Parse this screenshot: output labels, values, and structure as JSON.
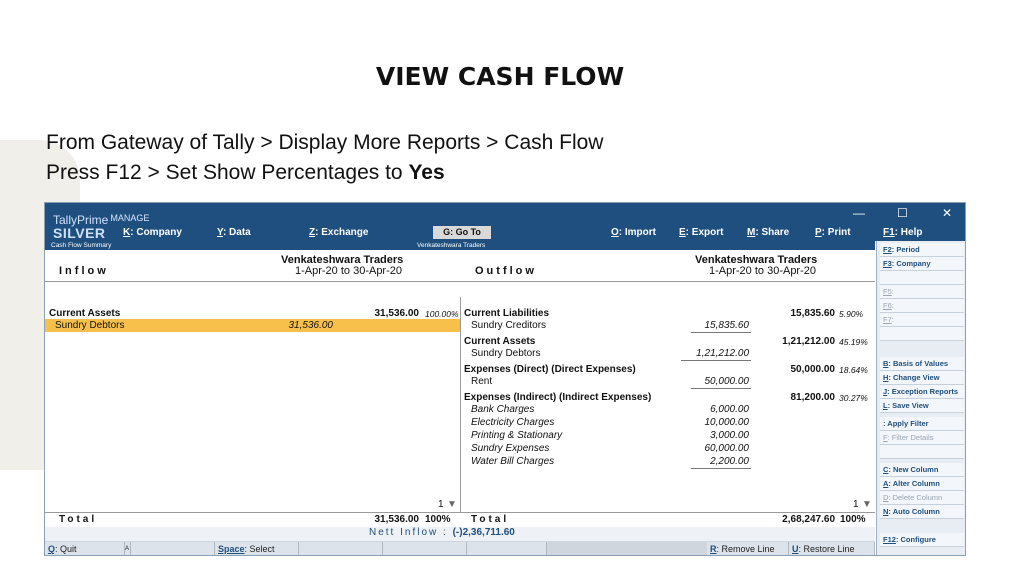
{
  "slide": {
    "title": "VIEW CASH FLOW",
    "line1": "From Gateway of Tally > Display More Reports > Cash Flow",
    "line2_prefix": "Press F12 > Set Show Percentages to ",
    "line2_bold": "Yes"
  },
  "app": {
    "logo_top": "TallyPrime",
    "logo_manage": "MANAGE",
    "logo_bottom": "SILVER",
    "menu": [
      {
        "key": "K",
        "label": ": Company"
      },
      {
        "key": "Y",
        "label": ": Data"
      },
      {
        "key": "Z",
        "label": ": Exchange"
      },
      {
        "key": "O",
        "label": ": Import"
      },
      {
        "key": "E",
        "label": ": Export"
      },
      {
        "key": "M",
        "label": ": Share"
      },
      {
        "key": "P",
        "label": ": Print"
      },
      {
        "key": "F1",
        "label": ": Help"
      }
    ],
    "goto": "G: Go To",
    "win_minimize": "—",
    "win_maximize": "☐",
    "win_close": "✕",
    "report_name": "Cash Flow Summary",
    "company_short": "Venkateshwara Traders"
  },
  "report": {
    "left_heading": "Inflow",
    "right_heading": "Outflow",
    "company": "Venkateshwara Traders",
    "period": "1-Apr-20 to 30-Apr-20",
    "inflow": {
      "group": "Current Assets",
      "group_amount": "31,536.00",
      "group_pct": "100.00%",
      "items": [
        {
          "name": "Sundry Debtors",
          "amount": "31,536.00"
        }
      ],
      "page": "1",
      "total_label": "Total",
      "total_amount": "31,536.00",
      "total_pct": "100%"
    },
    "outflow": {
      "groups": [
        {
          "name": "Current Liabilities",
          "amount": "15,835.60",
          "pct": "5.90%",
          "items": [
            {
              "name": "Sundry Creditors",
              "amount": "15,835.60"
            }
          ]
        },
        {
          "name": "Current Assets",
          "amount": "1,21,212.00",
          "pct": "45.19%",
          "items": [
            {
              "name": "Sundry Debtors",
              "amount": "1,21,212.00"
            }
          ]
        },
        {
          "name": "Expenses (Direct) (Direct Expenses)",
          "amount": "50,000.00",
          "pct": "18.64%",
          "items": [
            {
              "name": "Rent",
              "amount": "50,000.00"
            }
          ]
        },
        {
          "name": "Expenses (Indirect) (Indirect Expenses)",
          "amount": "81,200.00",
          "pct": "30.27%",
          "items": [
            {
              "name": "Bank Charges",
              "amount": "6,000.00"
            },
            {
              "name": "Electricity Charges",
              "amount": "10,000.00"
            },
            {
              "name": "Printing & Stationary",
              "amount": "3,000.00"
            },
            {
              "name": "Sundry Expenses",
              "amount": "60,000.00"
            },
            {
              "name": "Water Bill Charges",
              "amount": "2,200.00"
            }
          ]
        }
      ],
      "page": "1",
      "total_label": "Total",
      "total_amount": "2,68,247.60",
      "total_pct": "100%"
    },
    "nett_label": "Nett Inflow :",
    "nett_value": "(-)2,36,711.60"
  },
  "bottom_bar": [
    {
      "key": "Q",
      "label": ": Quit"
    },
    {
      "key": "",
      "label": "A"
    },
    {
      "key": "",
      "label": ""
    },
    {
      "key": "",
      "label": ""
    },
    {
      "key": "Space",
      "label": ": Select"
    },
    {
      "key": "",
      "label": ""
    },
    {
      "key": "",
      "label": ""
    },
    {
      "key": "R",
      "label": ": Remove Line"
    },
    {
      "key": "U",
      "label": ": Restore Line"
    }
  ],
  "side_panel": [
    {
      "key": "F2",
      "label": ": Period",
      "dim": false
    },
    {
      "key": "F3",
      "label": ": Company",
      "dim": false
    },
    {
      "key": "",
      "label": "",
      "dim": true
    },
    {
      "key": "F5",
      "label": ":",
      "dim": true
    },
    {
      "key": "F6",
      "label": ":",
      "dim": true
    },
    {
      "key": "F7",
      "label": ":",
      "dim": true
    },
    {
      "key": "",
      "label": "",
      "dim": true
    },
    {
      "key": "B",
      "label": ": Basis of Values",
      "dim": false
    },
    {
      "key": "H",
      "label": ": Change View",
      "dim": false
    },
    {
      "key": "J",
      "label": ": Exception Reports",
      "dim": false
    },
    {
      "key": "L",
      "label": ": Save View",
      "dim": false
    },
    {
      "key": "",
      "label": ": Apply Filter",
      "dim": false
    },
    {
      "key": "F",
      "label": ": Filter Details",
      "dim": true
    },
    {
      "key": "",
      "label": "",
      "dim": true
    },
    {
      "key": "C",
      "label": ": New Column",
      "dim": false
    },
    {
      "key": "A",
      "label": ": Alter Column",
      "dim": false
    },
    {
      "key": "D",
      "label": ": Delete Column",
      "dim": true
    },
    {
      "key": "N",
      "label": ": Auto Column",
      "dim": false
    },
    {
      "key": "F12",
      "label": ": Configure",
      "dim": false
    }
  ]
}
